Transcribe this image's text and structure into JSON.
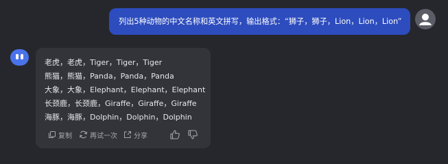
{
  "user_message": "列出5种动物的中文名称和英文拼写，输出格式：“狮子，狮子，Lion，Lion，Lion”",
  "reply_lines": [
    "老虎，老虎，Tiger，Tiger，Tiger",
    "熊猫，熊猫，Panda，Panda，Panda",
    "大象，大象，Elephant，Elephant，Elephant",
    "长颈鹿，长颈鹿，Giraffe，Giraffe，Giraffe",
    "海豚，海豚，Dolphin，Dolphin，Dolphin"
  ],
  "actions": {
    "copy": "复制",
    "retry": "再试一次",
    "share": "分享"
  },
  "icons": {
    "copy": "copy-icon",
    "retry": "refresh-icon",
    "share": "share-icon",
    "like": "thumbs-up-icon",
    "dislike": "thumbs-down-icon",
    "user": "user-avatar-icon",
    "bot": "bot-avatar-icon"
  },
  "colors": {
    "background": "#26272c",
    "user_bubble": "#2d4cbe",
    "bot_bubble": "#33343a",
    "bot_avatar": "#4a72ea"
  }
}
